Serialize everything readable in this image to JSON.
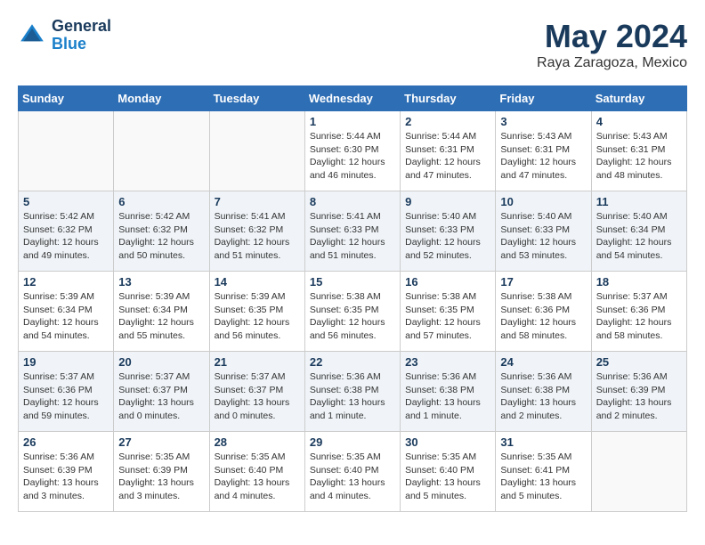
{
  "logo": {
    "general": "General",
    "blue": "Blue"
  },
  "header": {
    "month": "May 2024",
    "location": "Raya Zaragoza, Mexico"
  },
  "weekdays": [
    "Sunday",
    "Monday",
    "Tuesday",
    "Wednesday",
    "Thursday",
    "Friday",
    "Saturday"
  ],
  "weeks": [
    [
      {
        "day": "",
        "info": ""
      },
      {
        "day": "",
        "info": ""
      },
      {
        "day": "",
        "info": ""
      },
      {
        "day": "1",
        "info": "Sunrise: 5:44 AM\nSunset: 6:30 PM\nDaylight: 12 hours\nand 46 minutes."
      },
      {
        "day": "2",
        "info": "Sunrise: 5:44 AM\nSunset: 6:31 PM\nDaylight: 12 hours\nand 47 minutes."
      },
      {
        "day": "3",
        "info": "Sunrise: 5:43 AM\nSunset: 6:31 PM\nDaylight: 12 hours\nand 47 minutes."
      },
      {
        "day": "4",
        "info": "Sunrise: 5:43 AM\nSunset: 6:31 PM\nDaylight: 12 hours\nand 48 minutes."
      }
    ],
    [
      {
        "day": "5",
        "info": "Sunrise: 5:42 AM\nSunset: 6:32 PM\nDaylight: 12 hours\nand 49 minutes."
      },
      {
        "day": "6",
        "info": "Sunrise: 5:42 AM\nSunset: 6:32 PM\nDaylight: 12 hours\nand 50 minutes."
      },
      {
        "day": "7",
        "info": "Sunrise: 5:41 AM\nSunset: 6:32 PM\nDaylight: 12 hours\nand 51 minutes."
      },
      {
        "day": "8",
        "info": "Sunrise: 5:41 AM\nSunset: 6:33 PM\nDaylight: 12 hours\nand 51 minutes."
      },
      {
        "day": "9",
        "info": "Sunrise: 5:40 AM\nSunset: 6:33 PM\nDaylight: 12 hours\nand 52 minutes."
      },
      {
        "day": "10",
        "info": "Sunrise: 5:40 AM\nSunset: 6:33 PM\nDaylight: 12 hours\nand 53 minutes."
      },
      {
        "day": "11",
        "info": "Sunrise: 5:40 AM\nSunset: 6:34 PM\nDaylight: 12 hours\nand 54 minutes."
      }
    ],
    [
      {
        "day": "12",
        "info": "Sunrise: 5:39 AM\nSunset: 6:34 PM\nDaylight: 12 hours\nand 54 minutes."
      },
      {
        "day": "13",
        "info": "Sunrise: 5:39 AM\nSunset: 6:34 PM\nDaylight: 12 hours\nand 55 minutes."
      },
      {
        "day": "14",
        "info": "Sunrise: 5:39 AM\nSunset: 6:35 PM\nDaylight: 12 hours\nand 56 minutes."
      },
      {
        "day": "15",
        "info": "Sunrise: 5:38 AM\nSunset: 6:35 PM\nDaylight: 12 hours\nand 56 minutes."
      },
      {
        "day": "16",
        "info": "Sunrise: 5:38 AM\nSunset: 6:35 PM\nDaylight: 12 hours\nand 57 minutes."
      },
      {
        "day": "17",
        "info": "Sunrise: 5:38 AM\nSunset: 6:36 PM\nDaylight: 12 hours\nand 58 minutes."
      },
      {
        "day": "18",
        "info": "Sunrise: 5:37 AM\nSunset: 6:36 PM\nDaylight: 12 hours\nand 58 minutes."
      }
    ],
    [
      {
        "day": "19",
        "info": "Sunrise: 5:37 AM\nSunset: 6:36 PM\nDaylight: 12 hours\nand 59 minutes."
      },
      {
        "day": "20",
        "info": "Sunrise: 5:37 AM\nSunset: 6:37 PM\nDaylight: 13 hours\nand 0 minutes."
      },
      {
        "day": "21",
        "info": "Sunrise: 5:37 AM\nSunset: 6:37 PM\nDaylight: 13 hours\nand 0 minutes."
      },
      {
        "day": "22",
        "info": "Sunrise: 5:36 AM\nSunset: 6:38 PM\nDaylight: 13 hours\nand 1 minute."
      },
      {
        "day": "23",
        "info": "Sunrise: 5:36 AM\nSunset: 6:38 PM\nDaylight: 13 hours\nand 1 minute."
      },
      {
        "day": "24",
        "info": "Sunrise: 5:36 AM\nSunset: 6:38 PM\nDaylight: 13 hours\nand 2 minutes."
      },
      {
        "day": "25",
        "info": "Sunrise: 5:36 AM\nSunset: 6:39 PM\nDaylight: 13 hours\nand 2 minutes."
      }
    ],
    [
      {
        "day": "26",
        "info": "Sunrise: 5:36 AM\nSunset: 6:39 PM\nDaylight: 13 hours\nand 3 minutes."
      },
      {
        "day": "27",
        "info": "Sunrise: 5:35 AM\nSunset: 6:39 PM\nDaylight: 13 hours\nand 3 minutes."
      },
      {
        "day": "28",
        "info": "Sunrise: 5:35 AM\nSunset: 6:40 PM\nDaylight: 13 hours\nand 4 minutes."
      },
      {
        "day": "29",
        "info": "Sunrise: 5:35 AM\nSunset: 6:40 PM\nDaylight: 13 hours\nand 4 minutes."
      },
      {
        "day": "30",
        "info": "Sunrise: 5:35 AM\nSunset: 6:40 PM\nDaylight: 13 hours\nand 5 minutes."
      },
      {
        "day": "31",
        "info": "Sunrise: 5:35 AM\nSunset: 6:41 PM\nDaylight: 13 hours\nand 5 minutes."
      },
      {
        "day": "",
        "info": ""
      }
    ]
  ]
}
